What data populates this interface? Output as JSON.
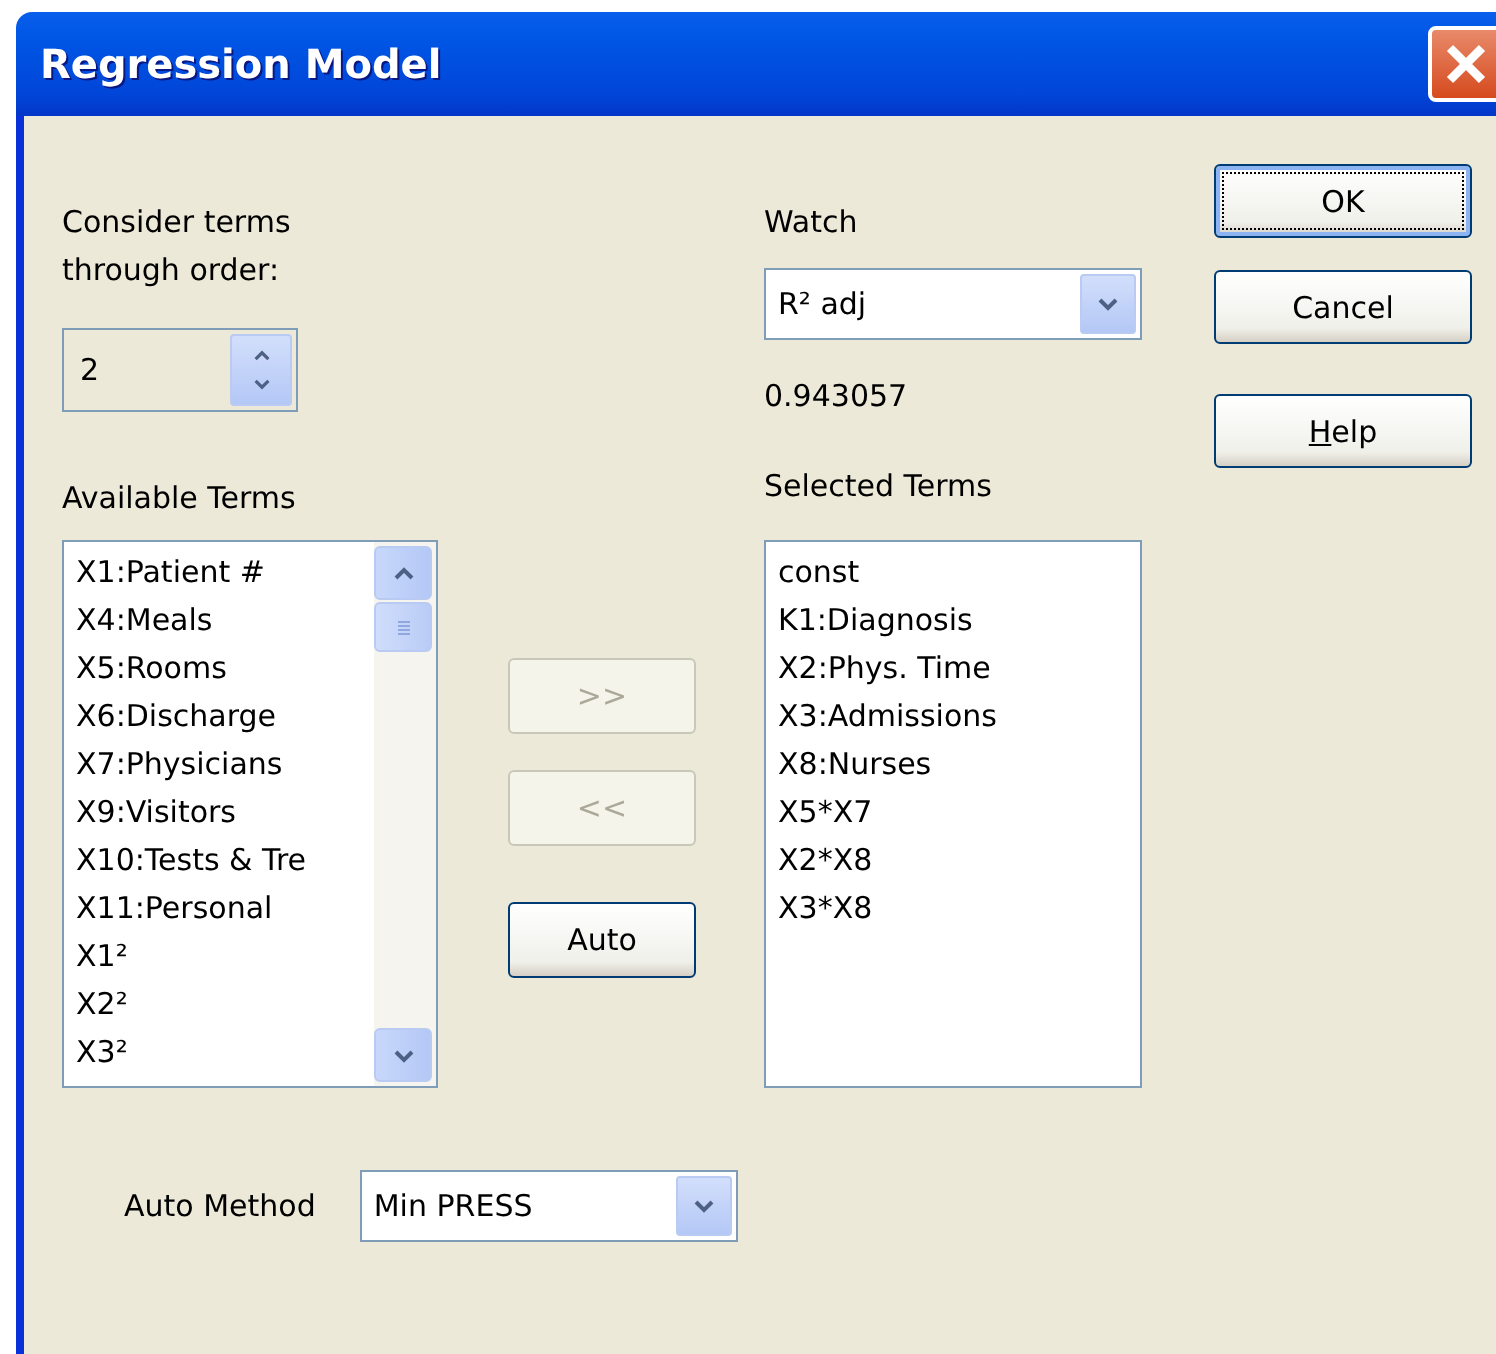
{
  "window": {
    "title": "Regression Model"
  },
  "order": {
    "label": "Consider terms through order:",
    "value": "2"
  },
  "available_terms": {
    "label": "Available Terms",
    "items": [
      {
        "text": "X1:Patient #",
        "selected": false
      },
      {
        "text": "X4:Meals",
        "selected": false
      },
      {
        "text": "X5:Rooms",
        "selected": false
      },
      {
        "text": "X6:Discharge",
        "selected": false
      },
      {
        "text": "X7:Physicians",
        "selected": false
      },
      {
        "text": "X9:Visitors",
        "selected": false
      },
      {
        "text": "X10:Tests & Tre",
        "selected": false
      },
      {
        "text": "X11:Personal",
        "selected": false
      },
      {
        "text": "X1²",
        "selected": false
      },
      {
        "text": "X2²",
        "selected": false
      },
      {
        "text": "X3²",
        "selected": false
      }
    ]
  },
  "move_buttons": [
    {
      "label": ">>",
      "disabled": true
    },
    {
      "label": "<<",
      "disabled": true
    },
    {
      "label": "Auto",
      "disabled": false
    }
  ],
  "watch": {
    "label": "Watch",
    "value": "R² adj",
    "reading": "0.943057"
  },
  "selected_terms": {
    "label": "Selected Terms",
    "items": [
      {
        "text": "const",
        "selected": false
      },
      {
        "text": "K1:Diagnosis",
        "selected": false
      },
      {
        "text": "X2:Phys. Time",
        "selected": false
      },
      {
        "text": "X3:Admissions",
        "selected": false
      },
      {
        "text": "X8:Nurses",
        "selected": false
      },
      {
        "text": "X5*X7",
        "selected": false
      },
      {
        "text": "X2*X8",
        "selected": false
      },
      {
        "text": "X3*X8",
        "selected": false
      }
    ]
  },
  "dialog_buttons": [
    {
      "label_parts": [
        {
          "text": "OK",
          "underlined": false
        }
      ],
      "default": true
    },
    {
      "label_parts": [
        {
          "text": "Cancel",
          "underlined": false
        }
      ],
      "default": false
    },
    {
      "label_parts": [
        {
          "text": "H",
          "underlined": true
        },
        {
          "text": "elp",
          "underlined": false
        }
      ],
      "default": false
    }
  ],
  "auto_method": {
    "label": "Auto Method",
    "value": "Min PRESS"
  }
}
